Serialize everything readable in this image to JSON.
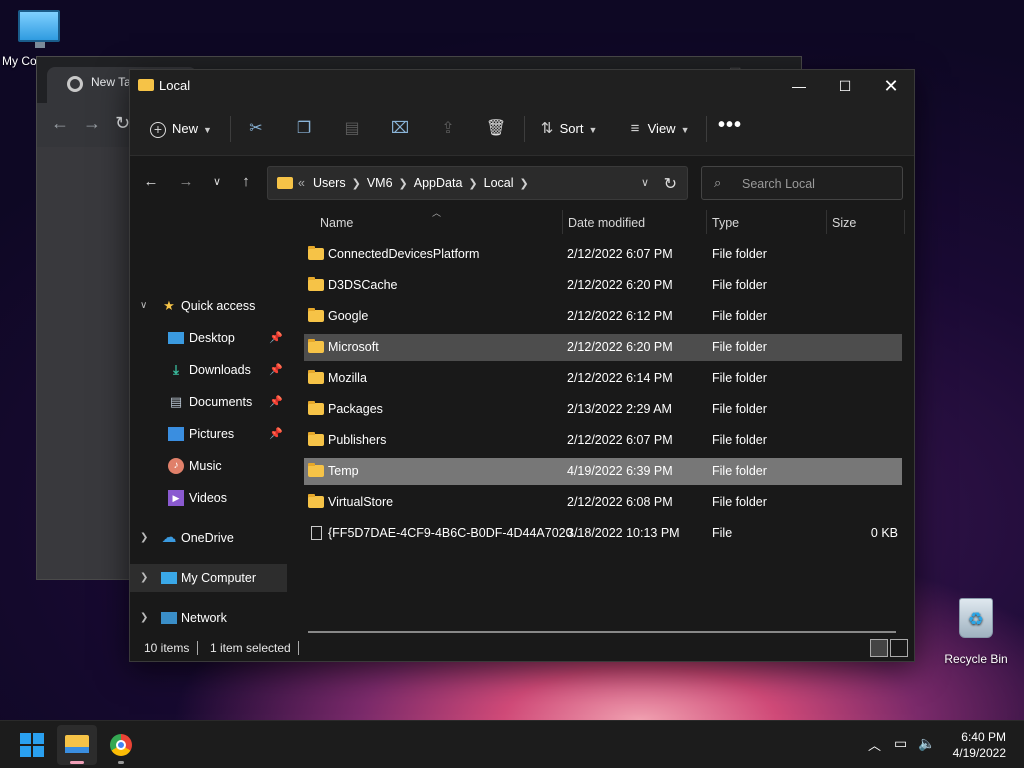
{
  "desktop": {
    "icons": [
      {
        "label": "My Co"
      },
      {
        "label": "Recycle Bin"
      }
    ]
  },
  "chrome": {
    "tab_title": "New Tab"
  },
  "explorer": {
    "title": "Local",
    "toolbar": {
      "new_label": "New",
      "sort_label": "Sort",
      "view_label": "View",
      "more_label": "•••"
    },
    "address": {
      "overflow": "«",
      "path": [
        "Users",
        "VM6",
        "AppData",
        "Local"
      ]
    },
    "search": {
      "placeholder": "Search Local"
    },
    "nav": {
      "quick_access": "Quick access",
      "items": [
        "Desktop",
        "Downloads",
        "Documents",
        "Pictures",
        "Music",
        "Videos"
      ],
      "onedrive": "OneDrive",
      "my_computer": "My Computer",
      "network": "Network"
    },
    "columns": {
      "name": "Name",
      "date": "Date modified",
      "type": "Type",
      "size": "Size"
    },
    "files": [
      {
        "name": "ConnectedDevicesPlatform",
        "date": "2/12/2022 6:07 PM",
        "type": "File folder",
        "size": ""
      },
      {
        "name": "D3DSCache",
        "date": "2/12/2022 6:20 PM",
        "type": "File folder",
        "size": ""
      },
      {
        "name": "Google",
        "date": "2/12/2022 6:12 PM",
        "type": "File folder",
        "size": ""
      },
      {
        "name": "Microsoft",
        "date": "2/12/2022 6:20 PM",
        "type": "File folder",
        "size": ""
      },
      {
        "name": "Mozilla",
        "date": "2/12/2022 6:14 PM",
        "type": "File folder",
        "size": ""
      },
      {
        "name": "Packages",
        "date": "2/13/2022 2:29 AM",
        "type": "File folder",
        "size": ""
      },
      {
        "name": "Publishers",
        "date": "2/12/2022 6:07 PM",
        "type": "File folder",
        "size": ""
      },
      {
        "name": "Temp",
        "date": "4/19/2022 6:39 PM",
        "type": "File folder",
        "size": ""
      },
      {
        "name": "VirtualStore",
        "date": "2/12/2022 6:08 PM",
        "type": "File folder",
        "size": ""
      },
      {
        "name": "{FF5D7DAE-4CF9-4B6C-B0DF-4D44A7020...",
        "date": "3/18/2022 10:13 PM",
        "type": "File",
        "size": "0 KB"
      }
    ],
    "status": {
      "count": "10 items",
      "selection": "1 item selected"
    }
  },
  "taskbar": {
    "time": "6:40 PM",
    "date": "4/19/2022"
  }
}
